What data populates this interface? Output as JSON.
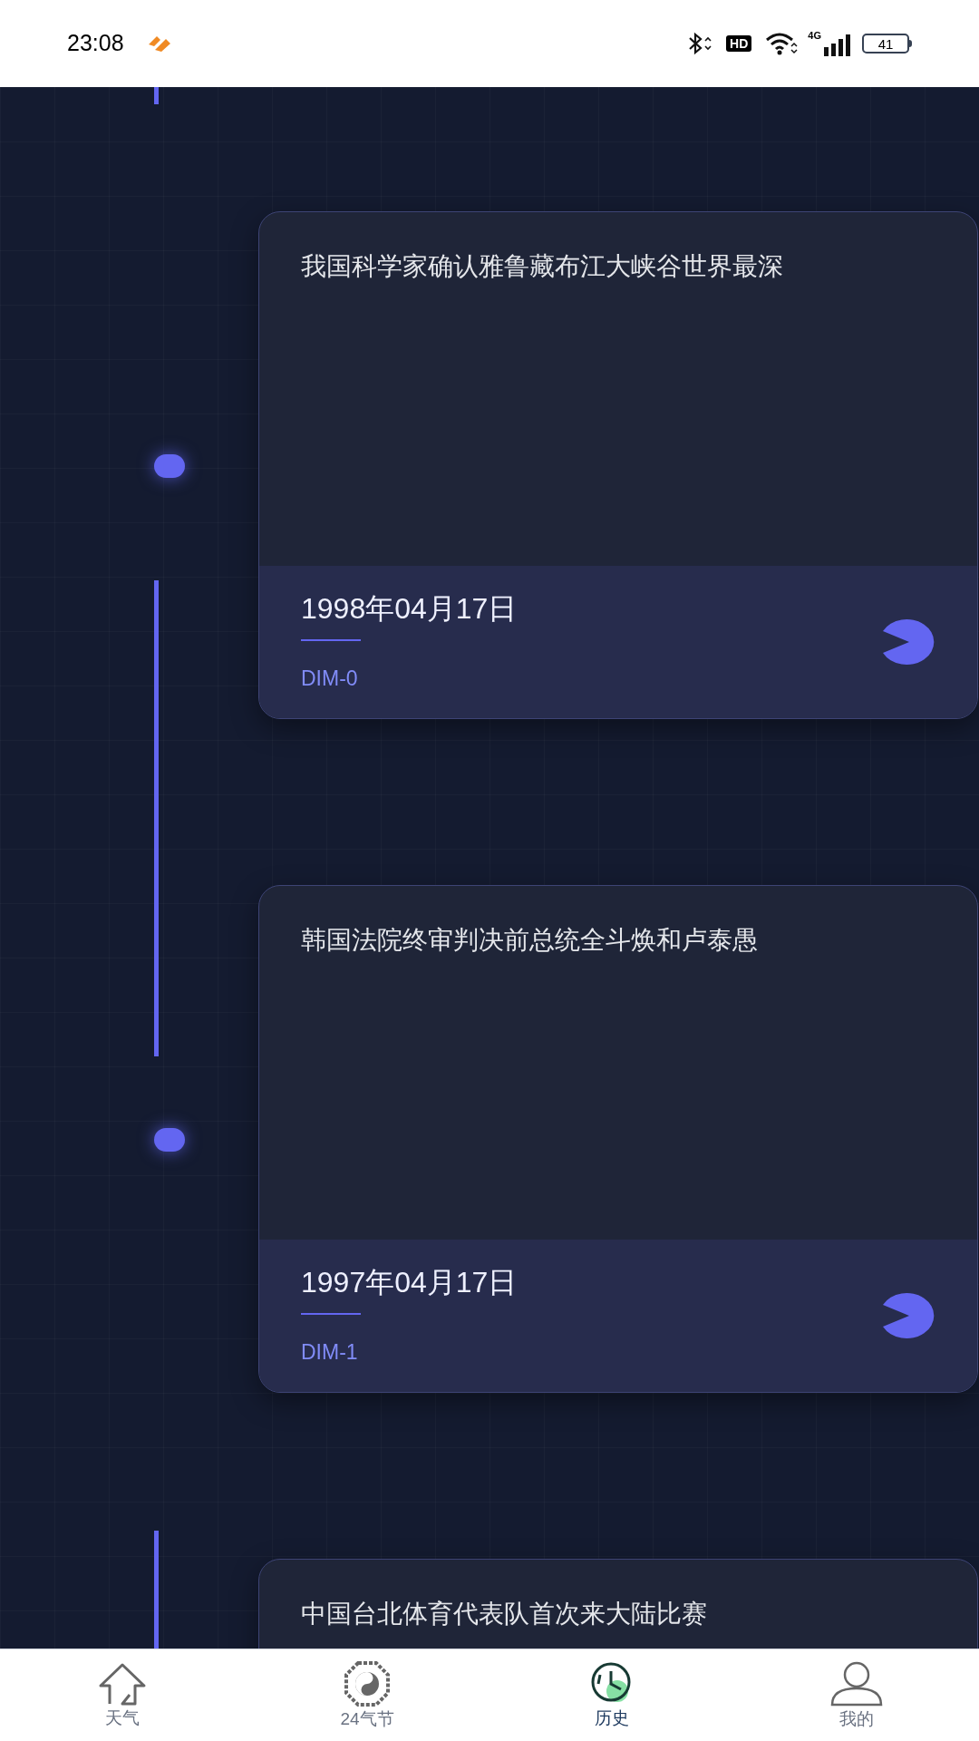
{
  "status_bar": {
    "time": "23:08",
    "hd": "HD",
    "network": "4G",
    "battery": "41"
  },
  "events": [
    {
      "title": "我国科学家确认雅鲁藏布江大峡谷世界最深",
      "date": "1998年04月17日",
      "tag": "DIM-0"
    },
    {
      "title": "韩国法院终审判决前总统全斗焕和卢泰愚",
      "date": "1997年04月17日",
      "tag": "DIM-1"
    },
    {
      "title": "中国台北体育代表队首次来大陆比赛"
    }
  ],
  "nav": [
    {
      "label": "天气",
      "kind": "home",
      "selected": false
    },
    {
      "label": "24气节",
      "kind": "bagua",
      "selected": false
    },
    {
      "label": "历史",
      "kind": "clock",
      "selected": true
    },
    {
      "label": "我的",
      "kind": "user",
      "selected": false
    }
  ]
}
